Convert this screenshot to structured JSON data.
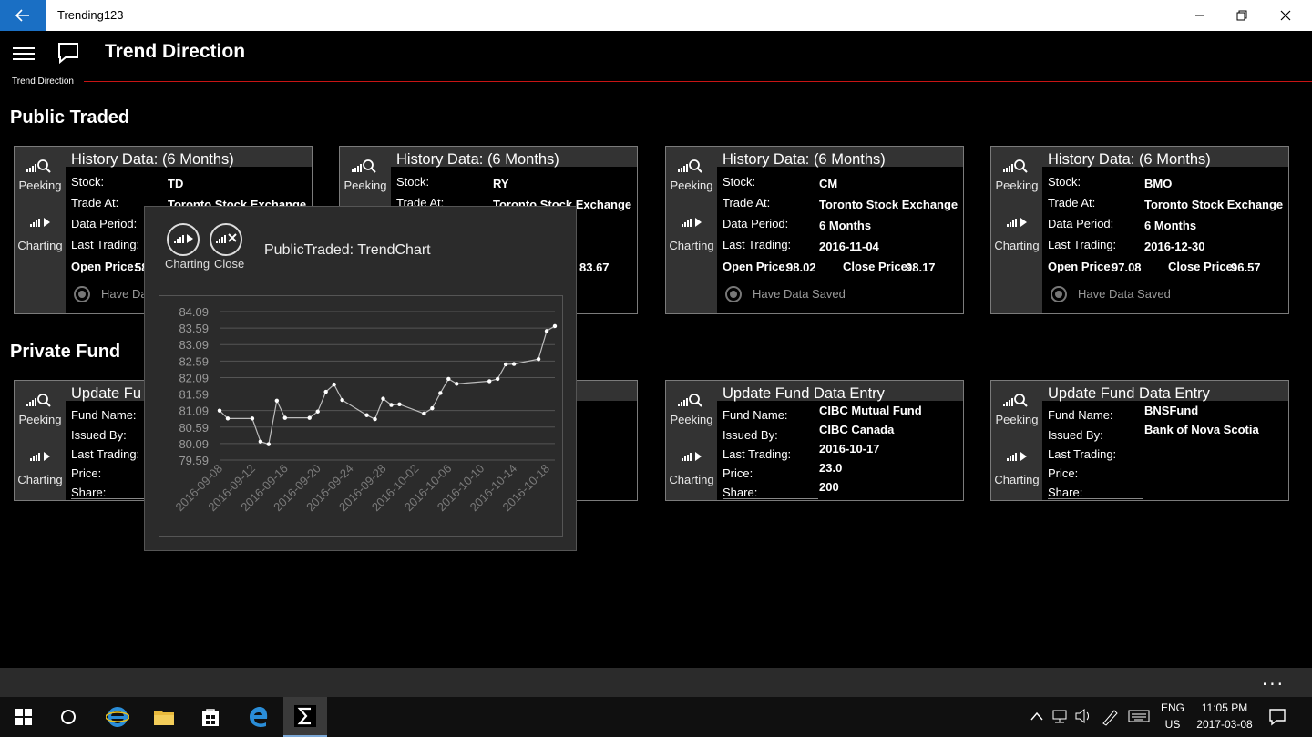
{
  "window": {
    "title": "Trending123"
  },
  "header": {
    "title": "Trend Direction",
    "breadcrumb": "Trend Direction"
  },
  "public": {
    "section_title": "Public Traded",
    "cards": [
      {
        "title": "History Data: (6 Months)",
        "stock_label": "Stock:",
        "stock": "TD",
        "trade_label": "Trade At:",
        "trade": "Toronto Stock Exchange",
        "period_label": "Data Period:",
        "period": "",
        "last_label": "Last Trading:",
        "last": "",
        "open_label": "Open Price:",
        "open": "58",
        "close_label": "",
        "close": "",
        "saved": "Have Da"
      },
      {
        "title": "History Data: (6 Months)",
        "stock_label": "Stock:",
        "stock": "RY",
        "trade_label": "Trade At:",
        "trade": "Toronto Stock Exchange",
        "period_label": "",
        "period": "",
        "last_label": "",
        "last": "",
        "open_label": "",
        "open": "",
        "close_label": "",
        "close": "83.67",
        "saved": ""
      },
      {
        "title": "History Data: (6 Months)",
        "stock_label": "Stock:",
        "stock": "CM",
        "trade_label": "Trade At:",
        "trade": "Toronto Stock Exchange",
        "period_label": "Data Period:",
        "period": "6 Months",
        "last_label": "Last Trading:",
        "last": "2016-11-04",
        "open_label": "Open Price:",
        "open": "98.02",
        "close_label": "Close Price:",
        "close": "98.17",
        "saved": "Have Data Saved"
      },
      {
        "title": "History Data: (6 Months)",
        "stock_label": "Stock:",
        "stock": "BMO",
        "trade_label": "Trade At:",
        "trade": "Toronto Stock Exchange",
        "period_label": "Data Period:",
        "period": "6 Months",
        "last_label": "Last Trading:",
        "last": "2016-12-30",
        "open_label": "Open Price:",
        "open": "97.08",
        "close_label": "Close Price:",
        "close": "96.57",
        "saved": "Have Data Saved"
      }
    ]
  },
  "private": {
    "section_title": "Private Fund",
    "cards": [
      {
        "title": "Update Fu",
        "name_label": "Fund Name:",
        "name": "",
        "issued_label": "Issued By:",
        "issued": "",
        "last_label": "Last Trading:",
        "last": "",
        "price_label": "Price:",
        "price": "",
        "share_label": "Share:",
        "share": ""
      },
      {
        "title": "",
        "name_label": "",
        "name": "nd",
        "issued_label": "",
        "issued": "",
        "last_label": "",
        "last": "",
        "price_label": "",
        "price": "",
        "share_label": "",
        "share": ""
      },
      {
        "title": "Update Fund Data Entry",
        "name_label": "Fund Name:",
        "name": "CIBC Mutual Fund",
        "issued_label": "Issued By:",
        "issued": "CIBC Canada",
        "last_label": "Last Trading:",
        "last": "2016-10-17",
        "price_label": "Price:",
        "price": "23.0",
        "share_label": "Share:",
        "share": "200"
      },
      {
        "title": "Update Fund Data Entry",
        "name_label": "Fund Name:",
        "name": "BNSFund",
        "issued_label": "Issued By:",
        "issued": "Bank of Nova Scotia",
        "last_label": "Last Trading:",
        "last": "",
        "price_label": "Price:",
        "price": "",
        "share_label": "Share:",
        "share": ""
      }
    ]
  },
  "side_buttons": {
    "peeking": "Peeking",
    "charting": "Charting"
  },
  "popup": {
    "title": "PublicTraded: TrendChart",
    "charting_label": "Charting",
    "close_label": "Close"
  },
  "chart_data": {
    "type": "line",
    "title": "",
    "xlabel": "",
    "ylabel": "",
    "ylim": [
      79.59,
      84.09
    ],
    "yticks": [
      "84.09",
      "83.59",
      "83.09",
      "82.59",
      "82.09",
      "81.59",
      "81.09",
      "80.59",
      "80.09",
      "79.59"
    ],
    "xticks": [
      "2016-09-08",
      "2016-09-12",
      "2016-09-16",
      "2016-09-20",
      "2016-09-24",
      "2016-09-28",
      "2016-10-02",
      "2016-10-06",
      "2016-10-10",
      "2016-10-14",
      "2016-10-18"
    ],
    "x": [
      "2016-09-08",
      "2016-09-09",
      "2016-09-12",
      "2016-09-13",
      "2016-09-14",
      "2016-09-15",
      "2016-09-16",
      "2016-09-19",
      "2016-09-20",
      "2016-09-21",
      "2016-09-22",
      "2016-09-23",
      "2016-09-26",
      "2016-09-27",
      "2016-09-28",
      "2016-09-29",
      "2016-09-30",
      "2016-10-03",
      "2016-10-04",
      "2016-10-05",
      "2016-10-06",
      "2016-10-07",
      "2016-10-11",
      "2016-10-12",
      "2016-10-13",
      "2016-10-14",
      "2016-10-17",
      "2016-10-18",
      "2016-10-19"
    ],
    "y": [
      81.09,
      80.85,
      80.85,
      80.15,
      80.07,
      81.39,
      80.87,
      80.87,
      81.06,
      81.66,
      81.88,
      81.41,
      80.95,
      80.83,
      81.45,
      81.26,
      81.28,
      81.0,
      81.16,
      81.62,
      82.05,
      81.9,
      81.98,
      82.05,
      82.49,
      82.5,
      82.65,
      83.5,
      83.65
    ]
  },
  "taskbar": {
    "lang_top": "ENG",
    "lang_bottom": "US",
    "time": "11:05 PM",
    "date": "2017-03-08"
  },
  "appbar": {
    "more": "..."
  }
}
